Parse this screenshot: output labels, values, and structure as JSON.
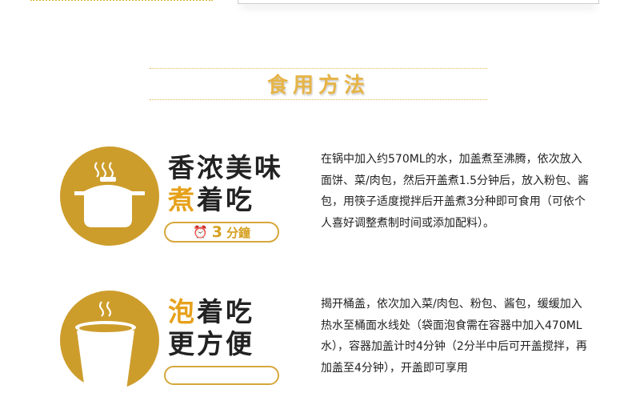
{
  "section_title": "食用方法",
  "methods": [
    {
      "title_line1": "香浓美味",
      "title_hl": "煮",
      "title_line2_rest": "着吃",
      "badge_number": "3",
      "badge_unit": "分鐘",
      "icon": "pot-icon",
      "description": "在锅中加入约570ML的水，加盖煮至沸腾，依次放入面饼、菜/肉包，然后开盖煮1.5分钟后，放入粉包、酱包，用筷子适度搅拌后开盖煮3分种即可食用（可依个人喜好调整煮制时间或添加配料）。"
    },
    {
      "title_hl": "泡",
      "title_line1_rest": "着吃",
      "title_line2": "更方便",
      "icon": "cup-icon",
      "description": "揭开桶盖，依次加入菜/肉包、粉包、酱包，缓缓加入热水至桶面水线处（袋面泡食需在容器中加入470ML水），容器加盖计时4分钟（2分半中后可开盖搅拌，再加盖至4分钟），开盖即可享用"
    }
  ],
  "colors": {
    "gold": "#cd9d2c",
    "accent": "#e6a11b",
    "title": "#e6b447"
  }
}
